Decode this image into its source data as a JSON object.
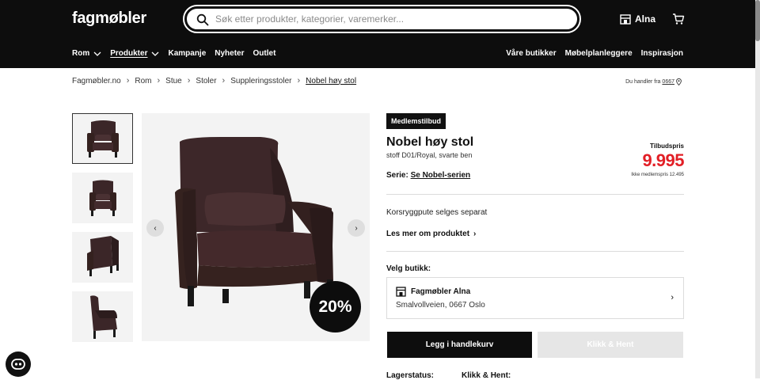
{
  "header": {
    "logo": "fagmøbler",
    "search_placeholder": "Søk etter produkter, kategorier, varemerker...",
    "store_label": "Alna",
    "nav_left": [
      {
        "label": "Rom"
      },
      {
        "label": "Produkter"
      },
      {
        "label": "Kampanje"
      },
      {
        "label": "Nyheter"
      },
      {
        "label": "Outlet"
      }
    ],
    "nav_right": [
      {
        "label": "Våre butikker"
      },
      {
        "label": "Møbelplanleggere"
      },
      {
        "label": "Inspirasjon"
      }
    ]
  },
  "breadcrumb": {
    "items": [
      "Fagmøbler.no",
      "Rom",
      "Stue",
      "Stoler",
      "Suppleringsstoler",
      "Nobel høy stol"
    ]
  },
  "location": {
    "prefix": "Du handler fra",
    "code": "0667"
  },
  "gallery": {
    "discount_badge": "20%"
  },
  "product": {
    "member_tag": "Medlemstilbud",
    "title": "Nobel høy stol",
    "subtitle": "stoff D01/Royal, svarte ben",
    "series_label": "Serie:",
    "series_link": "Se Nobel-serien",
    "price_label": "Tilbudspris",
    "price": "9.995",
    "price_old": "Ikke medlemspris 12.495",
    "note": "Korsryggpute selges separat",
    "read_more": "Les mer om produktet",
    "choose_store": "Velg butikk:",
    "store_name": "Fagmøbler Alna",
    "store_address": "Smalvollveien, 0667 Oslo",
    "add_to_cart": "Legg i handlekurv",
    "click_collect": "Klikk & Hent",
    "stock_label": "Lagerstatus:",
    "pickup_label": "Klikk & Hent:"
  },
  "colors": {
    "header_bg": "#0d0d0d",
    "price_red": "#e21f26",
    "thumb_bg": "#f3f3f3"
  }
}
